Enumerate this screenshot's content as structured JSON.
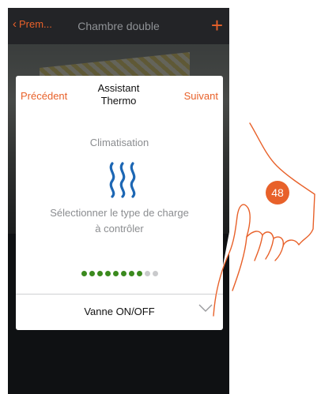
{
  "nav": {
    "back_label": "Prem...",
    "title": "Chambre double"
  },
  "dialog": {
    "previous_label": "Précédent",
    "title_line1": "Assistant",
    "title_line2": "Thermo",
    "next_label": "Suivant",
    "mode_label": "Climatisation",
    "instruction_line1": "Sélectionner le type de charge",
    "instruction_line2": "à contrôler",
    "progress": {
      "total_steps": 10,
      "completed_steps": 8
    },
    "selected_value": "Vanne ON/OFF"
  },
  "annotation": {
    "step_badge": "48"
  },
  "colors": {
    "accent": "#e8612a",
    "heat_icon": "#1d67b4",
    "progress_done": "#3b8a1e",
    "progress_todo": "#c9cacc"
  }
}
